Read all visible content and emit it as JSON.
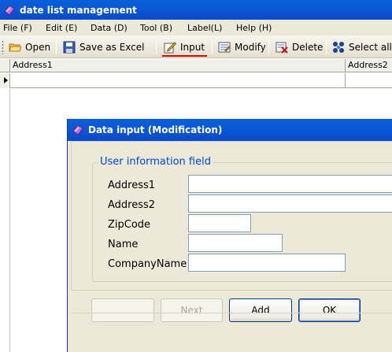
{
  "window": {
    "title": "date list management",
    "icon": "app-icon"
  },
  "menu": [
    {
      "label": "File (F)"
    },
    {
      "label": "Edit (E)"
    },
    {
      "label": "Data (D)"
    },
    {
      "label": "Tool (B)"
    },
    {
      "label": "Label(L)"
    },
    {
      "label": "Help (H)"
    }
  ],
  "toolbar": {
    "open": "Open",
    "save_excel": "Save as Excel",
    "input": "Input",
    "modify": "Modify",
    "delete": "Delete",
    "select_all": "Select all"
  },
  "grid": {
    "columns": [
      "Address1",
      "Address2"
    ]
  },
  "dialog": {
    "title": "Data input (Modification)",
    "group_title": "User information field",
    "fields": {
      "address1": {
        "label": "Address1",
        "value": ""
      },
      "address2": {
        "label": "Address2",
        "value": ""
      },
      "zipcode": {
        "label": "ZipCode",
        "value": ""
      },
      "name": {
        "label": "Name",
        "value": ""
      },
      "company": {
        "label": "CompanyName",
        "value": ""
      }
    },
    "buttons": {
      "prev": "",
      "next": "Next",
      "add": "Add",
      "ok": "OK"
    }
  },
  "colors": {
    "titlebar": "#0a5fd8",
    "group_title": "#0046d5",
    "highlight_underline": "#e00000"
  }
}
